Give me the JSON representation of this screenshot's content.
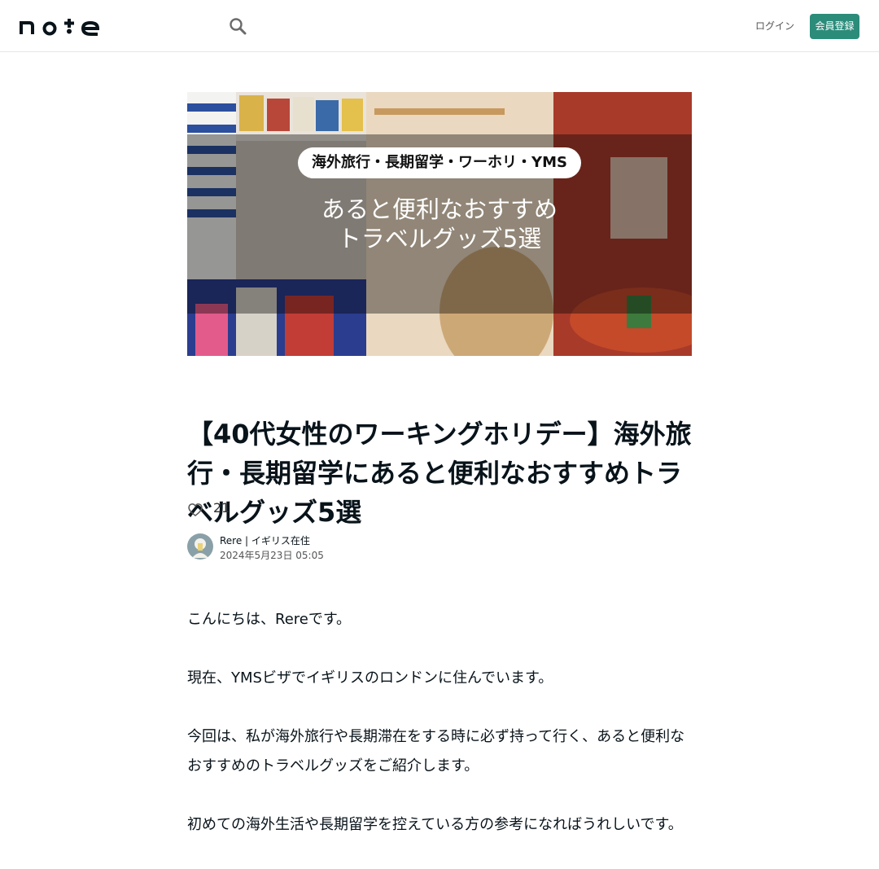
{
  "header": {
    "logo_text": "note",
    "search_icon": "search-icon",
    "login_label": "ログイン",
    "signup_label": "会員登録",
    "accent_color": "#2b8c7a"
  },
  "hero": {
    "pill_text": "海外旅行・長期留学・ワーホリ・YMS",
    "line1": "あると便利なおすすめ",
    "line2": "トラベルグッズ5選"
  },
  "article": {
    "title": "【40代女性のワーキングホリデー】海外旅行・長期留学にあると便利なおすすめトラベルグッズ5選",
    "like_count": "21",
    "author_name": "Rere | イギリス在住",
    "date": "2024年5月23日 05:05",
    "paragraphs": [
      "こんにちは、Rereです。",
      "現在、YMSビザでイギリスのロンドンに住んでいます。",
      "今回は、私が海外旅行や長期滞在をする時に必ず持って行く、あると便利なおすすめのトラベルグッズをご紹介します。",
      "初めての海外生活や長期留学を控えている方の参考になればうれしいです。"
    ]
  }
}
